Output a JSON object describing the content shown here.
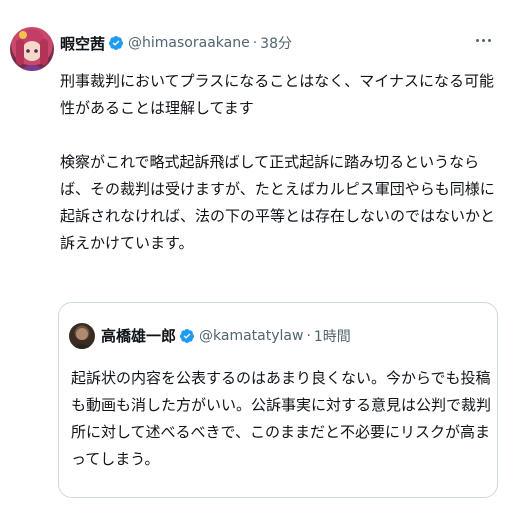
{
  "tweet": {
    "author_name": "暇空茜",
    "handle": "@himasoraakane",
    "separator": "·",
    "time": "38分",
    "paragraph1": "刑事裁判においてプラスになることはなく、マイナスになる可能性があることは理解してます",
    "paragraph2": "検察がこれで略式起訴飛ばして正式起訴に踏み切るというならば、その裁判は受けますが、たとえばカルピス軍団やらも同様に起訴されなければ、法の下の平等とは存在しないのではないかと訴えかけています。"
  },
  "quote": {
    "author_name": "高橋雄一郎",
    "handle": "@kamatatylaw",
    "separator": "·",
    "time": "1時間",
    "text": "起訴状の内容を公表するのはあまり良くない。今からでも投稿も動画も消した方がいい。公訴事実に対する意見は公判で裁判所に対して述べるべきで、このままだと不必要にリスクが高まってしまう。"
  },
  "colors": {
    "verified_blue": "#1d9bf0",
    "secondary_text": "#536471",
    "border": "#cfd9de"
  },
  "icons": [
    "verified-badge-icon",
    "more-options-icon"
  ]
}
